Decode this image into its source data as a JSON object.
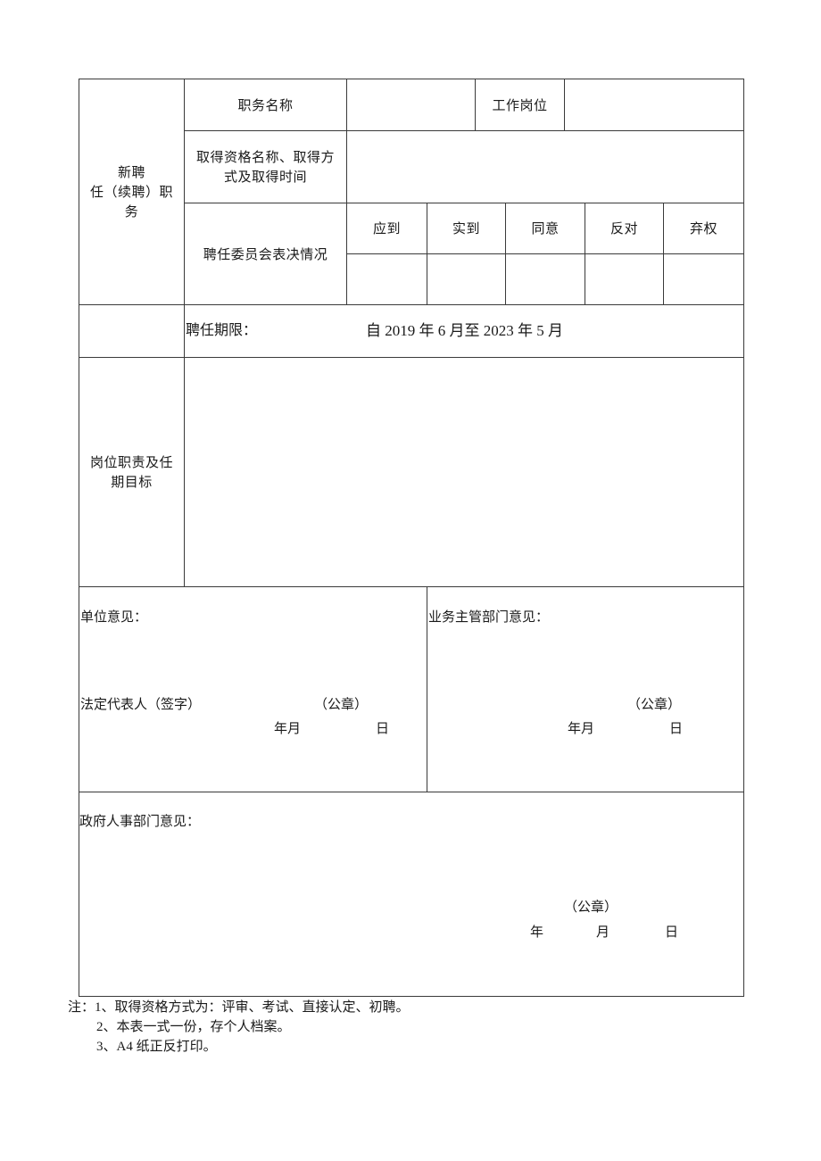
{
  "form": {
    "appointment_section": {
      "row_label": "新聘任（续聘）职务",
      "row_label_lines": [
        "新聘",
        "任（续聘）职",
        "务"
      ],
      "position_name_label": "职务名称",
      "position_name_value": "",
      "work_post_label": "工作岗位",
      "work_post_value": "",
      "qualification_label": "取得资格名称、取得方式及取得时间",
      "qualification_label_lines": [
        "取得资格名称、取得方",
        "式及取得时间"
      ],
      "qualification_value": "",
      "committee_vote_label": "聘任委员会表决情况",
      "vote_headers": [
        "应到",
        "实到",
        "同意",
        "反对",
        "弃权"
      ],
      "vote_values": [
        "",
        "",
        "",
        "",
        ""
      ]
    },
    "term": {
      "row_label": "",
      "label": "聘任期限：",
      "value": "自 2019 年 6 月至 2023 年 5 月"
    },
    "duties": {
      "label": "岗位职责及任期目标",
      "label_lines": [
        "岗位职责及任",
        "期目标"
      ],
      "value": ""
    },
    "unit_opinion": {
      "label": "单位意见：",
      "signature_label": "法定代表人（签字）",
      "seal_label": "（公章）",
      "date_year_month": "年月",
      "date_day": "日"
    },
    "supervisor_opinion": {
      "label": "业务主管部门意见：",
      "seal_label": "（公章）",
      "date_year_month": "年月",
      "date_day": "日"
    },
    "gov_hr_opinion": {
      "label": "政府人事部门意见：",
      "seal_label": "（公章）",
      "date_year": "年",
      "date_month": "月",
      "date_day": "日"
    }
  },
  "notes": [
    "注：1、取得资格方式为：评审、考试、直接认定、初聘。",
    "2、本表一式一份，存个人档案。",
    "3、A4 纸正反打印。"
  ]
}
